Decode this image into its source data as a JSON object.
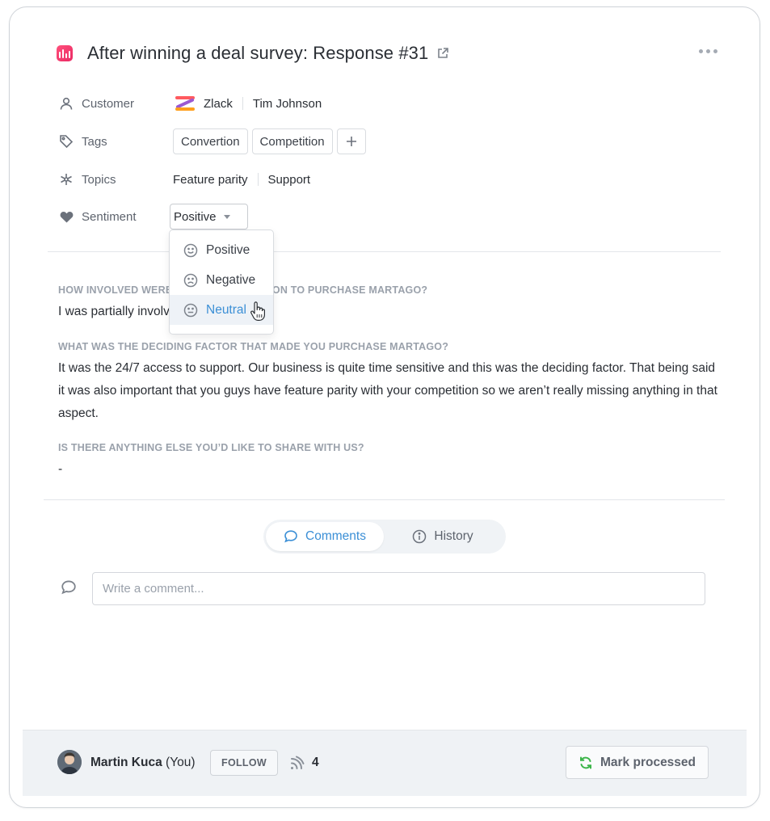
{
  "header": {
    "title": "After winning a deal survey: Response #31",
    "app_icon": "bar-chart-icon",
    "external_link_icon": "external-link-icon",
    "more_icon": "more-horizontal-icon"
  },
  "fields": {
    "customer": {
      "label": "Customer",
      "icon": "user-icon",
      "company": "Zlack",
      "person": "Tim Johnson"
    },
    "tags": {
      "label": "Tags",
      "icon": "tag-icon",
      "items": [
        "Convertion",
        "Competition"
      ],
      "add_icon": "plus-icon"
    },
    "topics": {
      "label": "Topics",
      "icon": "asterisk-icon",
      "items": [
        "Feature parity",
        "Support"
      ]
    },
    "sentiment": {
      "label": "Sentiment",
      "icon": "heart-icon",
      "selected": "Positive"
    }
  },
  "sentiment_dropdown": {
    "options": [
      {
        "label": "Positive",
        "icon": "smile-icon"
      },
      {
        "label": "Negative",
        "icon": "frown-icon"
      },
      {
        "label": "Neutral",
        "icon": "meh-icon",
        "hovered": true
      }
    ]
  },
  "qa": [
    {
      "question": "HOW INVOLVED WERE YOU IN THE DECISION TO PURCHASE MARTAGO?",
      "answer": "I was partially involved"
    },
    {
      "question": "WHAT WAS THE DECIDING FACTOR THAT MADE YOU PURCHASE MARTAGO?",
      "answer": "It was the 24/7 access to support. Our business is quite time sensitive and this was the deciding factor. That being said it was also important that you guys have feature parity with your competition so we aren’t really missing anything in that aspect."
    },
    {
      "question": "IS THERE ANYTHING ELSE YOU’D LIKE TO SHARE WITH US?",
      "answer": "-"
    }
  ],
  "tabs": [
    {
      "label": "Comments",
      "icon": "comment-icon",
      "active": true
    },
    {
      "label": "History",
      "icon": "info-icon",
      "active": false
    }
  ],
  "comment": {
    "placeholder": "Write a comment..."
  },
  "footer": {
    "user_name": "Martin Kuca",
    "user_suffix": "(You)",
    "follow_label": "FOLLOW",
    "followers_count": "4",
    "mark_processed_label": "Mark processed"
  },
  "colors": {
    "accent": "#3b8fd6",
    "brand": "#ff4f7b",
    "success": "#3cb54a"
  }
}
